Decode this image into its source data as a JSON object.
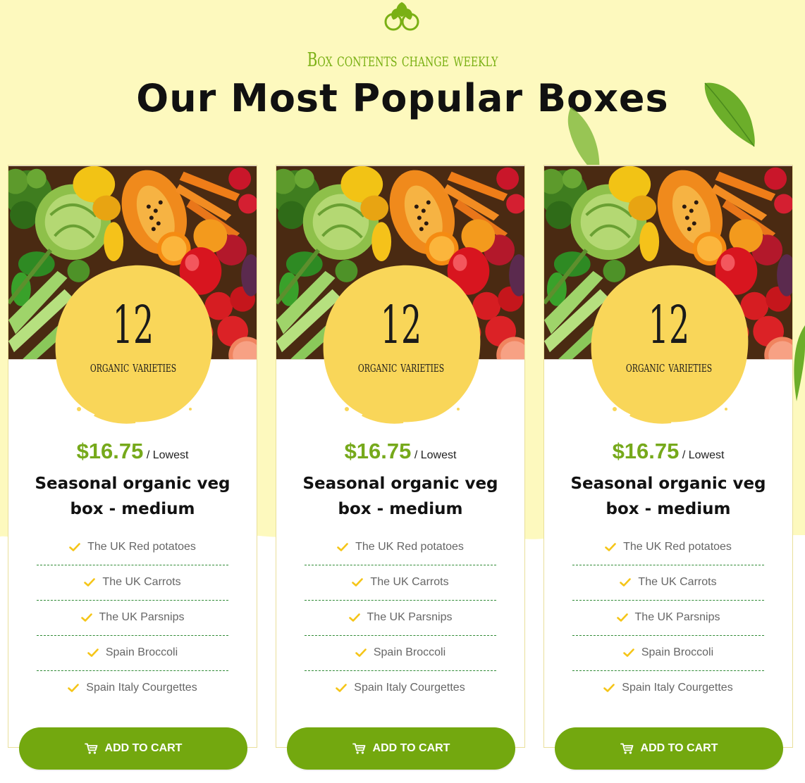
{
  "section": {
    "subtitle": "Box contents change weekly",
    "title": "Our Most Popular Boxes"
  },
  "colors": {
    "background": "#fdf9be",
    "accent_green": "#76a91b",
    "button_green": "#73a80f",
    "badge_yellow": "#f9d659",
    "check_yellow": "#f5c518"
  },
  "icons": {
    "logo": "leaf-logo-icon",
    "check": "check-icon",
    "cart": "cart-icon"
  },
  "cards": [
    {
      "image": "organic-vegetables-photo",
      "badge_number": "12",
      "badge_label": "organic varieties",
      "price": "$16.75",
      "price_suffix": "/ Lowest",
      "name": "Seasonal organic veg box - medium",
      "features": [
        "The UK Red potatoes",
        "The UK Carrots",
        "The UK Parsnips",
        "Spain Broccoli",
        "Spain Italy Courgettes"
      ],
      "button_label": "ADD TO CART"
    },
    {
      "image": "organic-vegetables-photo",
      "badge_number": "12",
      "badge_label": "organic varieties",
      "price": "$16.75",
      "price_suffix": "/ Lowest",
      "name": "Seasonal organic veg box - medium",
      "features": [
        "The UK Red potatoes",
        "The UK Carrots",
        "The UK Parsnips",
        "Spain Broccoli",
        "Spain Italy Courgettes"
      ],
      "button_label": "ADD TO CART"
    },
    {
      "image": "organic-vegetables-photo",
      "badge_number": "12",
      "badge_label": "organic varieties",
      "price": "$16.75",
      "price_suffix": "/ Lowest",
      "name": "Seasonal organic veg box - medium",
      "features": [
        "The UK Red potatoes",
        "The UK Carrots",
        "The UK Parsnips",
        "Spain Broccoli",
        "Spain Italy Courgettes"
      ],
      "button_label": "ADD TO CART"
    }
  ]
}
